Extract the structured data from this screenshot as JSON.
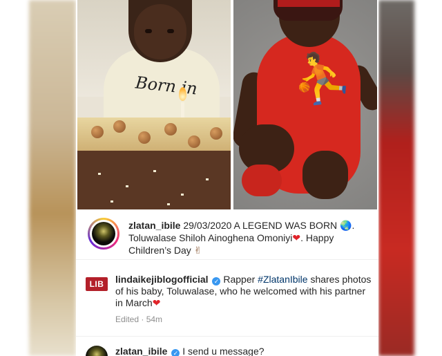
{
  "post": {
    "caption": {
      "username": "zlatan_ibile",
      "text_1": " 29/03/2020 A LEGEND WAS BORN ",
      "globe_emoji": "🌏",
      "text_2": ". Toluwalase Shiloh Ainoghena Omoniyi",
      "heart_emoji": "❤",
      "text_3": ". Happy Children’s Day ",
      "peace_emoji": "✌"
    },
    "photos": {
      "left_shirt_text": "Born in"
    }
  },
  "comments": [
    {
      "logo_text": "LIB",
      "username": "lindaikejiblogofficial",
      "verified_mark": "✓",
      "text_1": " Rapper ",
      "hashtag": "#ZlatanIbile",
      "text_2": " shares photos of his baby, Toluwalase, who he welcomed with his partner in March",
      "heart_emoji": "❤",
      "meta": "Edited · 54m"
    },
    {
      "username": "zlatan_ibile",
      "verified_mark": "✓",
      "text": " I send u message?"
    }
  ],
  "colors": {
    "accent_blue": "#3897f0",
    "lib_red": "#b3202a",
    "heart_red": "#e0242a"
  }
}
